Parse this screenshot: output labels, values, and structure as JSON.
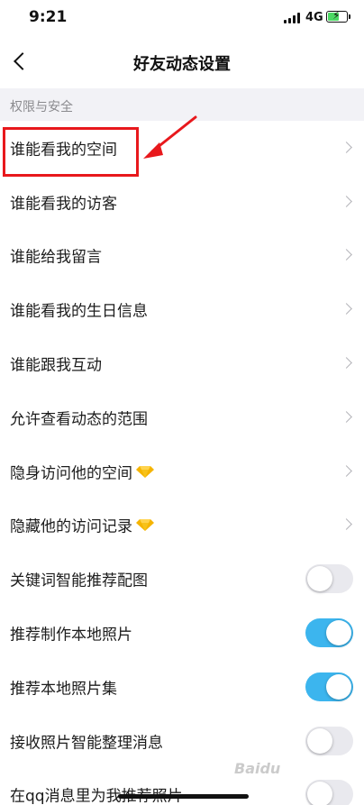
{
  "status_bar": {
    "time": "9:21",
    "network": "4G",
    "battery_level": 0.55
  },
  "nav": {
    "title": "好友动态设置"
  },
  "section": {
    "title": "权限与安全"
  },
  "rows": [
    {
      "label": "谁能看我的空间",
      "control": "chevron"
    },
    {
      "label": "谁能看我的访客",
      "control": "chevron"
    },
    {
      "label": "谁能给我留言",
      "control": "chevron"
    },
    {
      "label": "谁能看我的生日信息",
      "control": "chevron"
    },
    {
      "label": "谁能跟我互动",
      "control": "chevron"
    },
    {
      "label": "允许查看动态的范围",
      "control": "chevron"
    },
    {
      "label": "隐身访问他的空间",
      "control": "chevron",
      "icon": "gem-icon"
    },
    {
      "label": "隐藏他的访问记录",
      "control": "chevron",
      "icon": "gem-icon"
    },
    {
      "label": "关键词智能推荐配图",
      "control": "toggle",
      "on": false
    },
    {
      "label": "推荐制作本地照片",
      "control": "toggle",
      "on": true
    },
    {
      "label": "推荐本地照片集",
      "control": "toggle",
      "on": true
    },
    {
      "label": "接收照片智能整理消息",
      "control": "toggle",
      "on": false
    },
    {
      "label": "在qq消息里为我推荐照片",
      "control": "toggle",
      "on": false
    }
  ],
  "colors": {
    "toggle_on": "#3cb5ee",
    "annotation": "#e8181c",
    "gem": "#f5b400"
  },
  "watermark": "Baidu"
}
